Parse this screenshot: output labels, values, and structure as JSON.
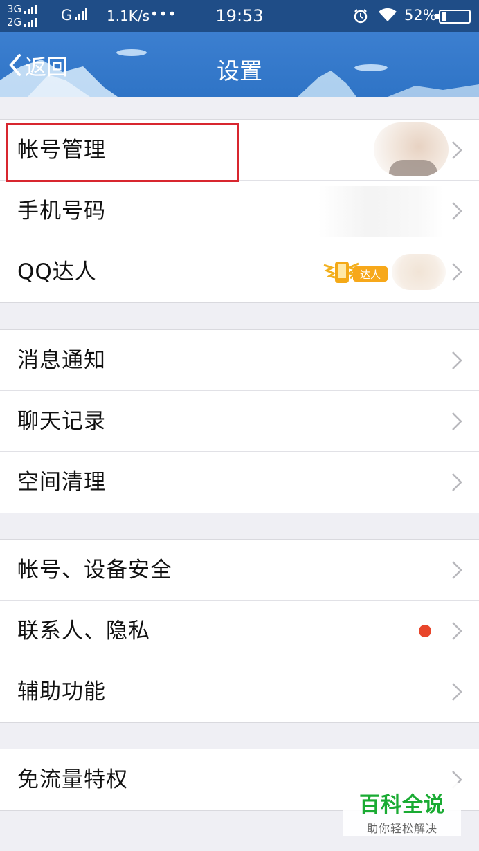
{
  "status_bar": {
    "net1": "3G",
    "net2": "2G",
    "net3": "G",
    "speed": "1.1K/s",
    "dots": "•••",
    "time": "19:53",
    "battery": "52%"
  },
  "nav": {
    "back_label": "返回",
    "title": "设置"
  },
  "groups": [
    {
      "items": [
        {
          "label": "帐号管理"
        },
        {
          "label": "手机号码"
        },
        {
          "label": "QQ达人",
          "badge": "达人"
        }
      ]
    },
    {
      "items": [
        {
          "label": "消息通知"
        },
        {
          "label": "聊天记录"
        },
        {
          "label": "空间清理"
        }
      ]
    },
    {
      "items": [
        {
          "label": "帐号、设备安全"
        },
        {
          "label": "联系人、隐私"
        },
        {
          "label": "辅助功能"
        }
      ]
    },
    {
      "items": [
        {
          "label": "免流量特权"
        }
      ]
    }
  ],
  "watermark": {
    "title": "百科全说",
    "subtitle": "助你轻松解决"
  },
  "colors": {
    "status_bar": "#1f4d87",
    "nav_bar": "#3479ca",
    "highlight": "#d8262f",
    "red_dot": "#e8452a",
    "watermark_green": "#1aab33"
  }
}
